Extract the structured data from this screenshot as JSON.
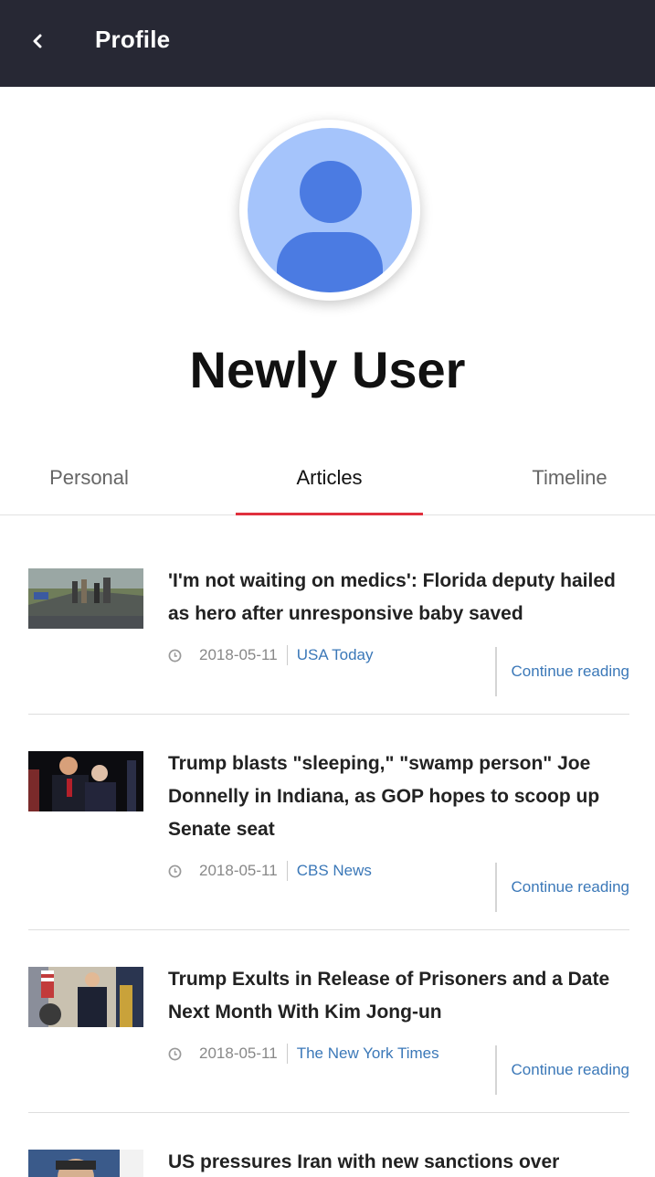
{
  "header": {
    "title": "Profile",
    "back_icon": "chevron-left-icon"
  },
  "profile": {
    "name": "Newly User",
    "avatar_icon": "user-avatar-icon"
  },
  "tabs": [
    {
      "label": "Personal",
      "active": false
    },
    {
      "label": "Articles",
      "active": true
    },
    {
      "label": "Timeline",
      "active": false
    }
  ],
  "accent_color": "#e0303d",
  "link_color": "#3b78b8",
  "articles": [
    {
      "title": "'I'm not waiting on medics': Florida deputy hailed as hero after unresponsive baby saved",
      "date": "2018-05-11",
      "source": "USA Today",
      "continue": "Continue reading",
      "thumb": "roadside-scene"
    },
    {
      "title": "Trump blasts \"sleeping,\" \"swamp person\" Joe Donnelly in Indiana, as GOP hopes to scoop up Senate seat",
      "date": "2018-05-11",
      "source": "CBS News",
      "continue": "Continue reading",
      "thumb": "rally-stage"
    },
    {
      "title": "Trump Exults in Release of Prisoners and a Date Next Month With Kim Jong-un",
      "date": "2018-05-11",
      "source": "The New York Times",
      "continue": "Continue reading",
      "thumb": "press-event"
    },
    {
      "title": "US pressures Iran with new sanctions over",
      "thumb": "portrait"
    }
  ]
}
